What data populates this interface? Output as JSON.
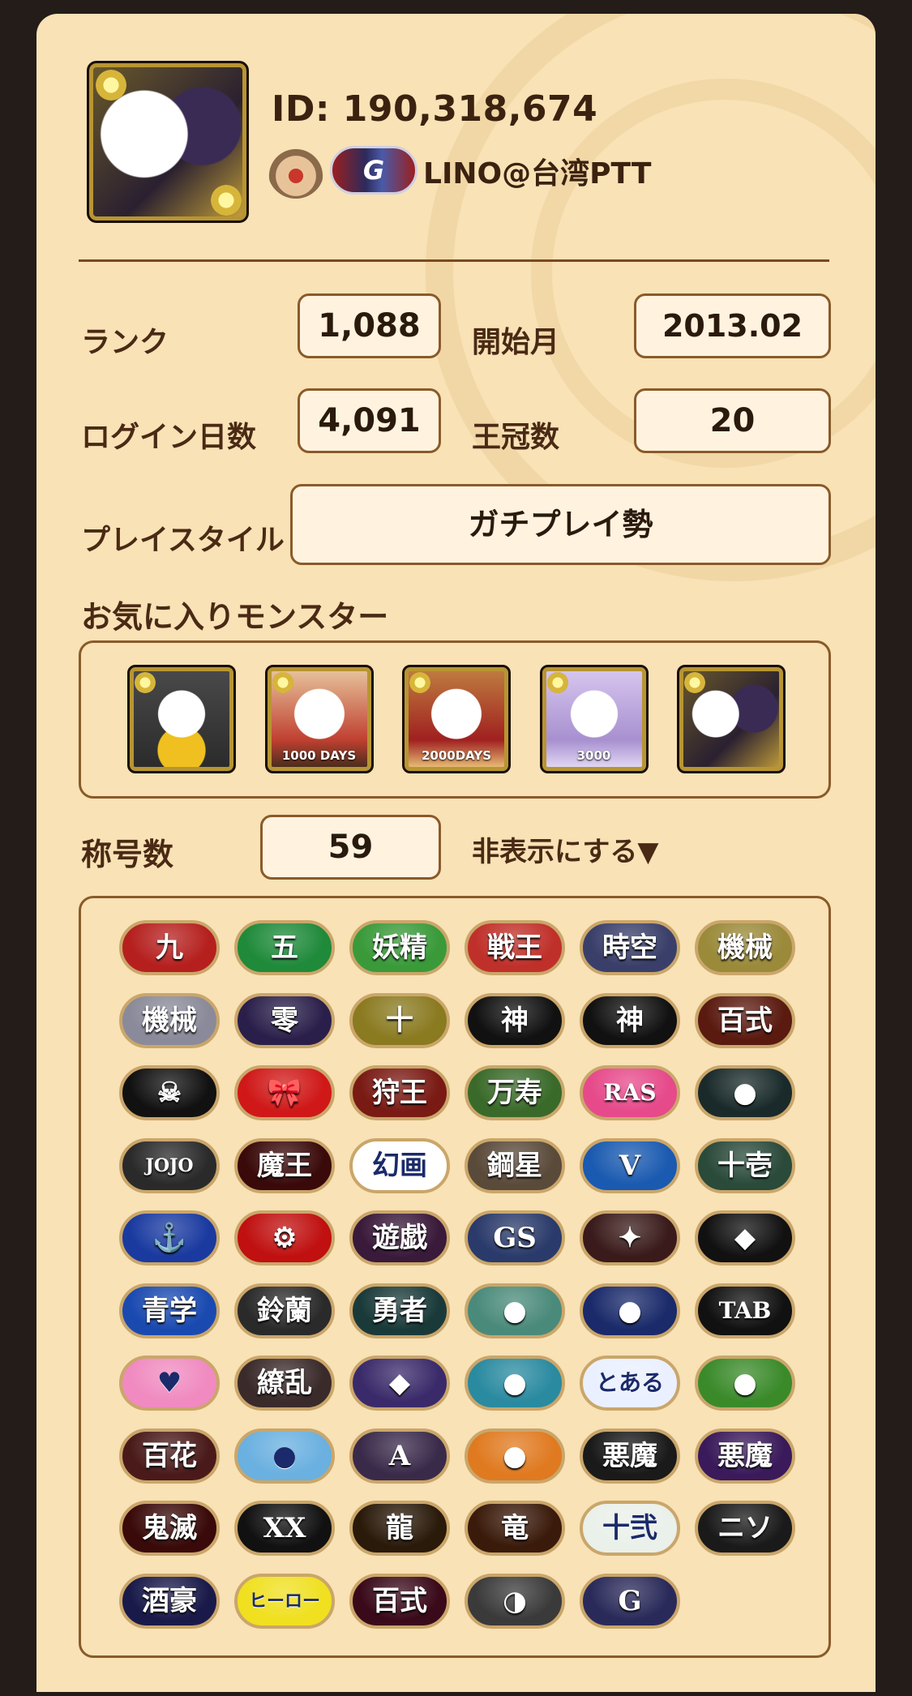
{
  "profile": {
    "id_text": "ID: 190,318,674",
    "name": "LINO@台湾PTT",
    "badge_icon": "crown-emblem-icon",
    "tag_badge_letter": "G"
  },
  "stats": {
    "rank_label": "ランク",
    "rank_value": "1,088",
    "start_label": "開始月",
    "start_value": "2013.02",
    "login_label": "ログイン日数",
    "login_value": "4,091",
    "crown_label": "王冠数",
    "crown_value": "20",
    "style_label": "プレイスタイル",
    "style_value": "ガチプレイ勢"
  },
  "favorites": {
    "label": "お気に入りモンスター",
    "items": [
      {
        "name": "tama-star",
        "caption": ""
      },
      {
        "name": "tama-1000days",
        "caption": "1000 DAYS"
      },
      {
        "name": "tama-2000days",
        "caption": "2000DAYS"
      },
      {
        "name": "tama-3000days",
        "caption": "3000"
      },
      {
        "name": "tama-dark",
        "caption": ""
      }
    ]
  },
  "titles": {
    "label": "称号数",
    "count": "59",
    "toggle_label": "非表示にする▼",
    "badges": [
      {
        "text": "九",
        "bg": "#b5201e"
      },
      {
        "text": "五",
        "bg": "#1f8a3a"
      },
      {
        "text": "妖精",
        "bg": "#3a9a3a"
      },
      {
        "text": "戦王",
        "bg": "#c0302a"
      },
      {
        "text": "時空",
        "bg": "#3a3f6a"
      },
      {
        "text": "機械",
        "bg": "#9a8a3a"
      },
      {
        "text": "機械",
        "bg": "#8a8a9a"
      },
      {
        "text": "零",
        "bg": "#2a1f4a"
      },
      {
        "text": "十",
        "bg": "#8a7a20"
      },
      {
        "text": "神",
        "bg": "#111111"
      },
      {
        "text": "神",
        "bg": "#111111"
      },
      {
        "text": "百式",
        "bg": "#5a1a10"
      },
      {
        "text": "☠",
        "bg": "#111111"
      },
      {
        "text": "🎀",
        "bg": "#d01818"
      },
      {
        "text": "狩王",
        "bg": "#7a1a14"
      },
      {
        "text": "万寿",
        "bg": "#3a6a2a"
      },
      {
        "text": "RAS",
        "bg": "#e64a8a"
      },
      {
        "text": "●",
        "bg": "#1a2a2a"
      },
      {
        "text": "JOJO",
        "bg": "#2a2a2a"
      },
      {
        "text": "魔王",
        "bg": "#3a0a0a"
      },
      {
        "text": "幻画",
        "bg": "#ffffff"
      },
      {
        "text": "鋼星",
        "bg": "#5a4a3a"
      },
      {
        "text": "V",
        "bg": "#1a5ab0"
      },
      {
        "text": "十壱",
        "bg": "#2a4a3a"
      },
      {
        "text": "⚓",
        "bg": "#1a3aa0"
      },
      {
        "text": "⚙",
        "bg": "#c01010"
      },
      {
        "text": "遊戯",
        "bg": "#3a1a3a"
      },
      {
        "text": "GS",
        "bg": "#2a3a6a"
      },
      {
        "text": "✦",
        "bg": "#3a1a1a"
      },
      {
        "text": "◆",
        "bg": "#111111"
      },
      {
        "text": "青学",
        "bg": "#1a4ab0"
      },
      {
        "text": "鈴蘭",
        "bg": "#2a2a2a"
      },
      {
        "text": "勇者",
        "bg": "#1a3a3a"
      },
      {
        "text": "●",
        "bg": "#4a8a7a"
      },
      {
        "text": "●",
        "bg": "#1a2a6a"
      },
      {
        "text": "TAB",
        "bg": "#111111"
      },
      {
        "text": "♥",
        "bg": "#f08ac0"
      },
      {
        "text": "繚乱",
        "bg": "#3a2a2a"
      },
      {
        "text": "◆",
        "bg": "#3a2a6a"
      },
      {
        "text": "●",
        "bg": "#2a8aa0"
      },
      {
        "text": "とある",
        "bg": "#eaf0ff"
      },
      {
        "text": "●",
        "bg": "#3a8a2a"
      },
      {
        "text": "百花",
        "bg": "#4a1a1a"
      },
      {
        "text": "●",
        "bg": "#6ab0e0"
      },
      {
        "text": "A",
        "bg": "#3a2a4a"
      },
      {
        "text": "●",
        "bg": "#e07a20"
      },
      {
        "text": "悪魔",
        "bg": "#1a1a1a"
      },
      {
        "text": "悪魔",
        "bg": "#3a1a5a"
      },
      {
        "text": "鬼滅",
        "bg": "#3a0a0a"
      },
      {
        "text": "XX",
        "bg": "#111111"
      },
      {
        "text": "龍",
        "bg": "#2a1a0a"
      },
      {
        "text": "竜",
        "bg": "#3a1a0a"
      },
      {
        "text": "十弐",
        "bg": "#eaf0ea"
      },
      {
        "text": "ニソ",
        "bg": "#1a1a1a"
      },
      {
        "text": "酒豪",
        "bg": "#1a1a4a"
      },
      {
        "text": "ヒーロー",
        "bg": "#f0e020"
      },
      {
        "text": "百式",
        "bg": "#3a0a1a"
      },
      {
        "text": "◑",
        "bg": "#3a3a3a"
      },
      {
        "text": "G",
        "bg": "#2a2a5a"
      }
    ]
  }
}
